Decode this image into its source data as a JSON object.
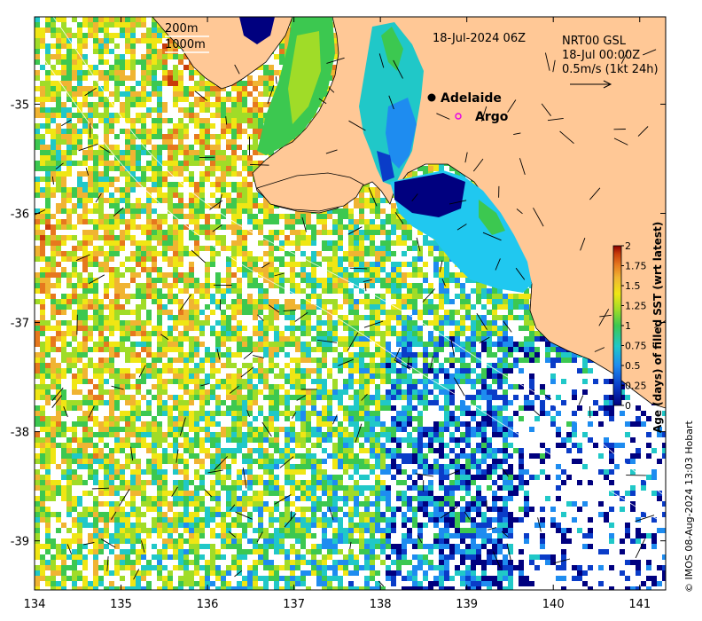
{
  "map": {
    "date_label": "18-Jul-2024 06Z",
    "depth_legend": [
      "200m",
      "1000m"
    ],
    "current_info": [
      "NRT00 GSL",
      "18-Jul 00:00Z",
      "0.5m/s (1kt 24h)"
    ],
    "places": [
      {
        "name": "Adelaide",
        "lon": 138.58,
        "lat": -34.93,
        "marker": "filled-circle"
      },
      {
        "name": "Argo",
        "lon": 138.92,
        "lat": -35.13,
        "marker": "open-circle-magenta"
      }
    ],
    "credit": "© IMOS 08-Aug-2024 13:03 Hobart",
    "lon_range": [
      134.0,
      141.3
    ],
    "lat_range": [
      -39.45,
      -34.2
    ]
  },
  "axes": {
    "x_ticks": [
      "134",
      "135",
      "136",
      "137",
      "138",
      "139",
      "140",
      "141"
    ],
    "y_ticks": [
      "-35",
      "-36",
      "-37",
      "-38",
      "-39"
    ]
  },
  "colorbar": {
    "label": "Age (days) of filled SST (wrt latest)",
    "ticks": [
      "0",
      "0.25",
      "0.5",
      "0.75",
      "1",
      "1.25",
      "1.5",
      "1.75",
      "2"
    ],
    "colors": [
      "#00007f",
      "#0a3cc8",
      "#1e8cf0",
      "#20c8c8",
      "#3cc850",
      "#a0dc28",
      "#f0e614",
      "#f0b432",
      "#e6781e",
      "#c83c0a",
      "#8c0000"
    ]
  },
  "colors": {
    "land": "#ffc896",
    "coast": "#000000",
    "shelf_contour": "#ffffff",
    "argo_marker": "#e600e6"
  }
}
